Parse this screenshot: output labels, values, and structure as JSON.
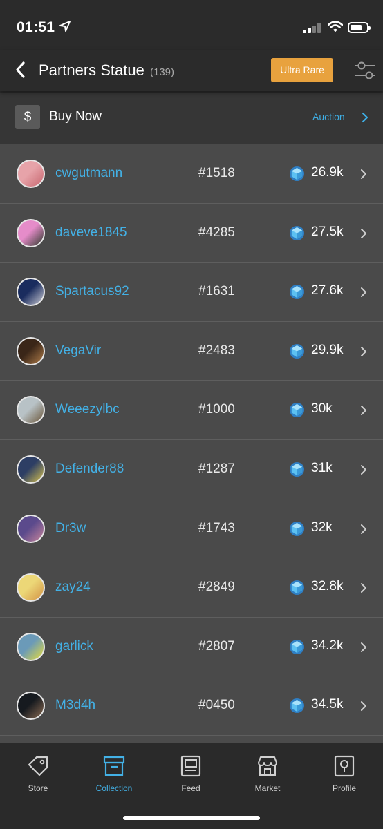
{
  "status": {
    "time": "01:51"
  },
  "header": {
    "title": "Partners Statue",
    "count": "(139)",
    "rarity_label": "Ultra Rare"
  },
  "buy": {
    "icon": "$",
    "label": "Buy Now",
    "auction_label": "Auction"
  },
  "colors": {
    "accent": "#43b1e6",
    "rare": "#e8a23e",
    "gem": "#4aa8e8"
  },
  "listings": [
    {
      "user": "cwgutmann",
      "serial": "#1518",
      "price": "26.9k",
      "avatar": [
        "#e7a3a9",
        "#c7666f"
      ]
    },
    {
      "user": "daveve1845",
      "serial": "#4285",
      "price": "27.5k",
      "avatar": [
        "#e58cc9",
        "#2e3a2c"
      ]
    },
    {
      "user": "Spartacus92",
      "serial": "#1631",
      "price": "27.6k",
      "avatar": [
        "#1a2c5e",
        "#c9c9d2"
      ]
    },
    {
      "user": "VegaVir",
      "serial": "#2483",
      "price": "29.9k",
      "avatar": [
        "#3a2618",
        "#b07d4a"
      ]
    },
    {
      "user": "Weeezylbc",
      "serial": "#1000",
      "price": "30k",
      "avatar": [
        "#b8c2c6",
        "#6a5538"
      ]
    },
    {
      "user": "Defender88",
      "serial": "#1287",
      "price": "31k",
      "avatar": [
        "#2d3e64",
        "#d6c14e"
      ]
    },
    {
      "user": "Dr3w",
      "serial": "#1743",
      "price": "32k",
      "avatar": [
        "#5b4a8c",
        "#c8859b"
      ]
    },
    {
      "user": "zay24",
      "serial": "#2849",
      "price": "32.8k",
      "avatar": [
        "#ecd777",
        "#d39245"
      ]
    },
    {
      "user": "garlick",
      "serial": "#2807",
      "price": "34.2k",
      "avatar": [
        "#6b9ab8",
        "#e6dd3a"
      ]
    },
    {
      "user": "M3d4h",
      "serial": "#0450",
      "price": "34.5k",
      "avatar": [
        "#161a1f",
        "#8a6b52"
      ]
    }
  ],
  "tabs": [
    {
      "label": "Store",
      "icon": "tag-icon",
      "active": false
    },
    {
      "label": "Collection",
      "icon": "box-icon",
      "active": true
    },
    {
      "label": "Feed",
      "icon": "feed-icon",
      "active": false
    },
    {
      "label": "Market",
      "icon": "market-icon",
      "active": false
    },
    {
      "label": "Profile",
      "icon": "profile-icon",
      "active": false
    }
  ]
}
